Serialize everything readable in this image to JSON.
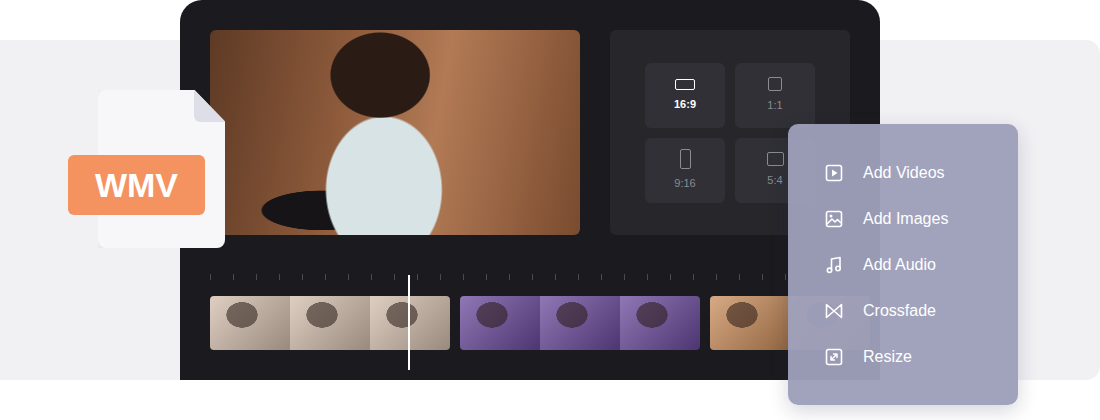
{
  "file_badge": {
    "label": "WMV"
  },
  "aspect_ratios": [
    {
      "label": "16:9",
      "selected": true
    },
    {
      "label": "1:1",
      "selected": false
    },
    {
      "label": "9:16",
      "selected": false
    },
    {
      "label": "5:4",
      "selected": false
    }
  ],
  "timeline": {
    "level": 0.31,
    "clips": [
      {
        "frames": 3,
        "color": "#d4bfae"
      },
      {
        "frames": 3,
        "color": "#6a4a9c"
      },
      {
        "frames": 2,
        "color": "#c98d5a"
      }
    ]
  },
  "menu": {
    "items": [
      {
        "label": "Add Videos"
      },
      {
        "label": "Add Images"
      },
      {
        "label": "Add Audio"
      },
      {
        "label": "Crossfade"
      },
      {
        "label": "Resize"
      }
    ]
  }
}
